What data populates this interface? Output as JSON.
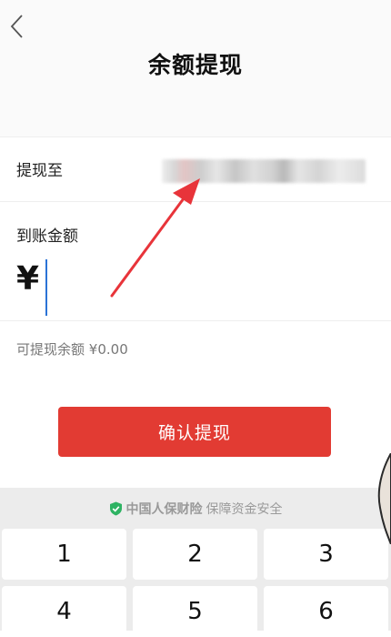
{
  "header": {
    "title": "余额提现"
  },
  "withdraw_to": {
    "label": "提现至"
  },
  "amount": {
    "label": "到账金额",
    "currency": "¥"
  },
  "available": {
    "label": "可提现余额",
    "value": "¥0.00"
  },
  "confirm": {
    "label": "确认提现"
  },
  "keypad": {
    "secure_brand": "中国人保财险",
    "secure_text": "保障资金安全",
    "keys": [
      "1",
      "2",
      "3",
      "4",
      "5",
      "6"
    ]
  },
  "colors": {
    "accent": "#e23b33",
    "caret": "#2b73d6",
    "arrow": "#e8343a",
    "shield": "#2eb363"
  }
}
